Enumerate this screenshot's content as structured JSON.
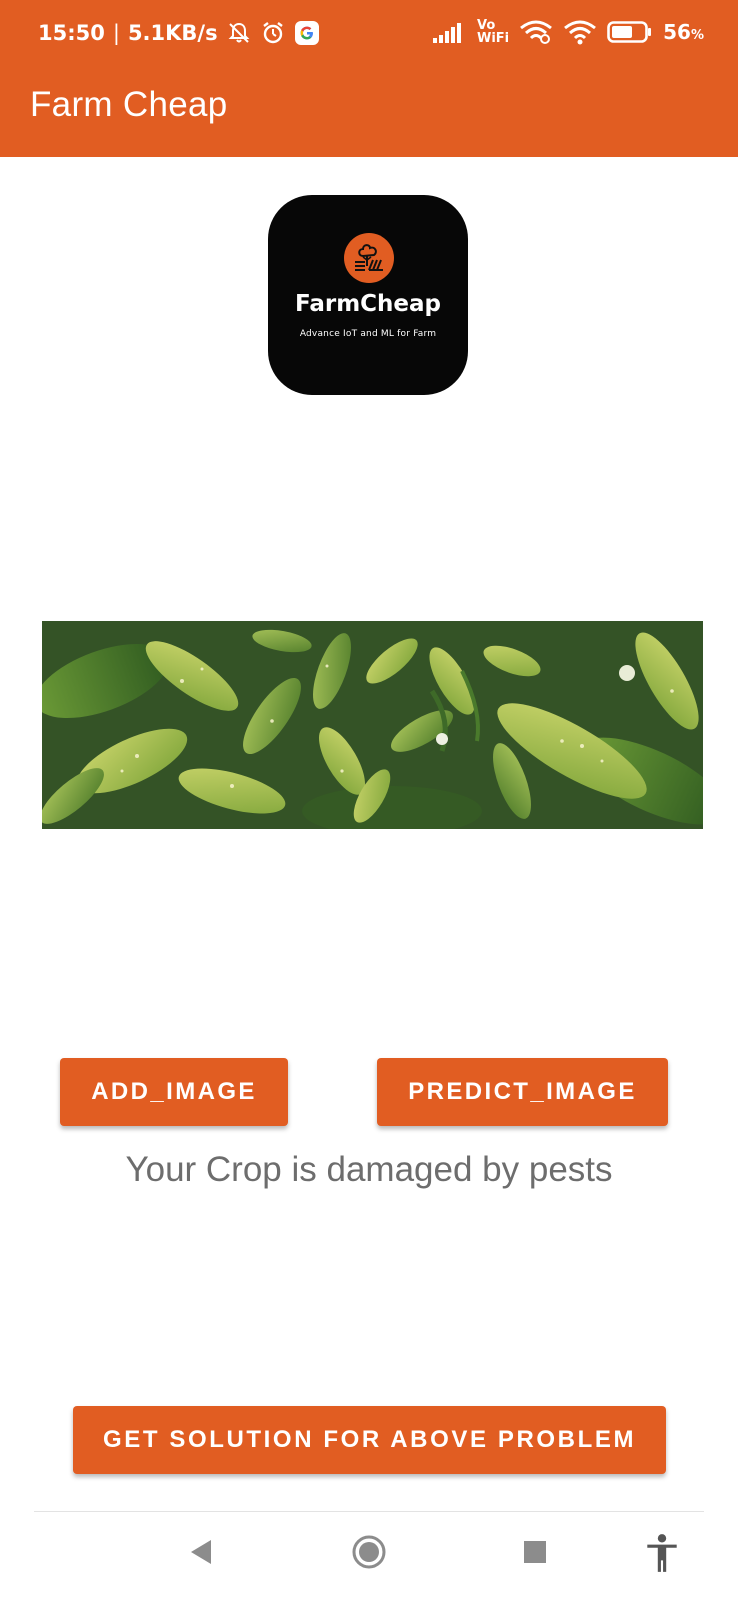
{
  "status_bar": {
    "time": "15:50",
    "speed": "5.1KB/s",
    "separator": "|",
    "network_label_top": "Vo",
    "network_label_bottom": "WiFi",
    "battery_percent": "56",
    "battery_unit": "%"
  },
  "toolbar": {
    "title": "Farm Cheap",
    "background_color": "#E15D22"
  },
  "logo": {
    "name": "FarmCheap",
    "tagline": "Advance IoT and ML for Farm",
    "accent_color": "#E15D22"
  },
  "crop_image": {
    "icon": "crop-leaf-photo"
  },
  "actions": {
    "add_image_label": "ADD_IMAGE",
    "predict_image_label": "PREDICT_IMAGE",
    "solution_label": "GET SOLUTION FOR ABOVE PROBLEM"
  },
  "result": {
    "text": "Your Crop is damaged by pests"
  },
  "navbar": {
    "icons": [
      "back-icon",
      "home-icon",
      "recents-icon",
      "accessibility-icon"
    ]
  }
}
